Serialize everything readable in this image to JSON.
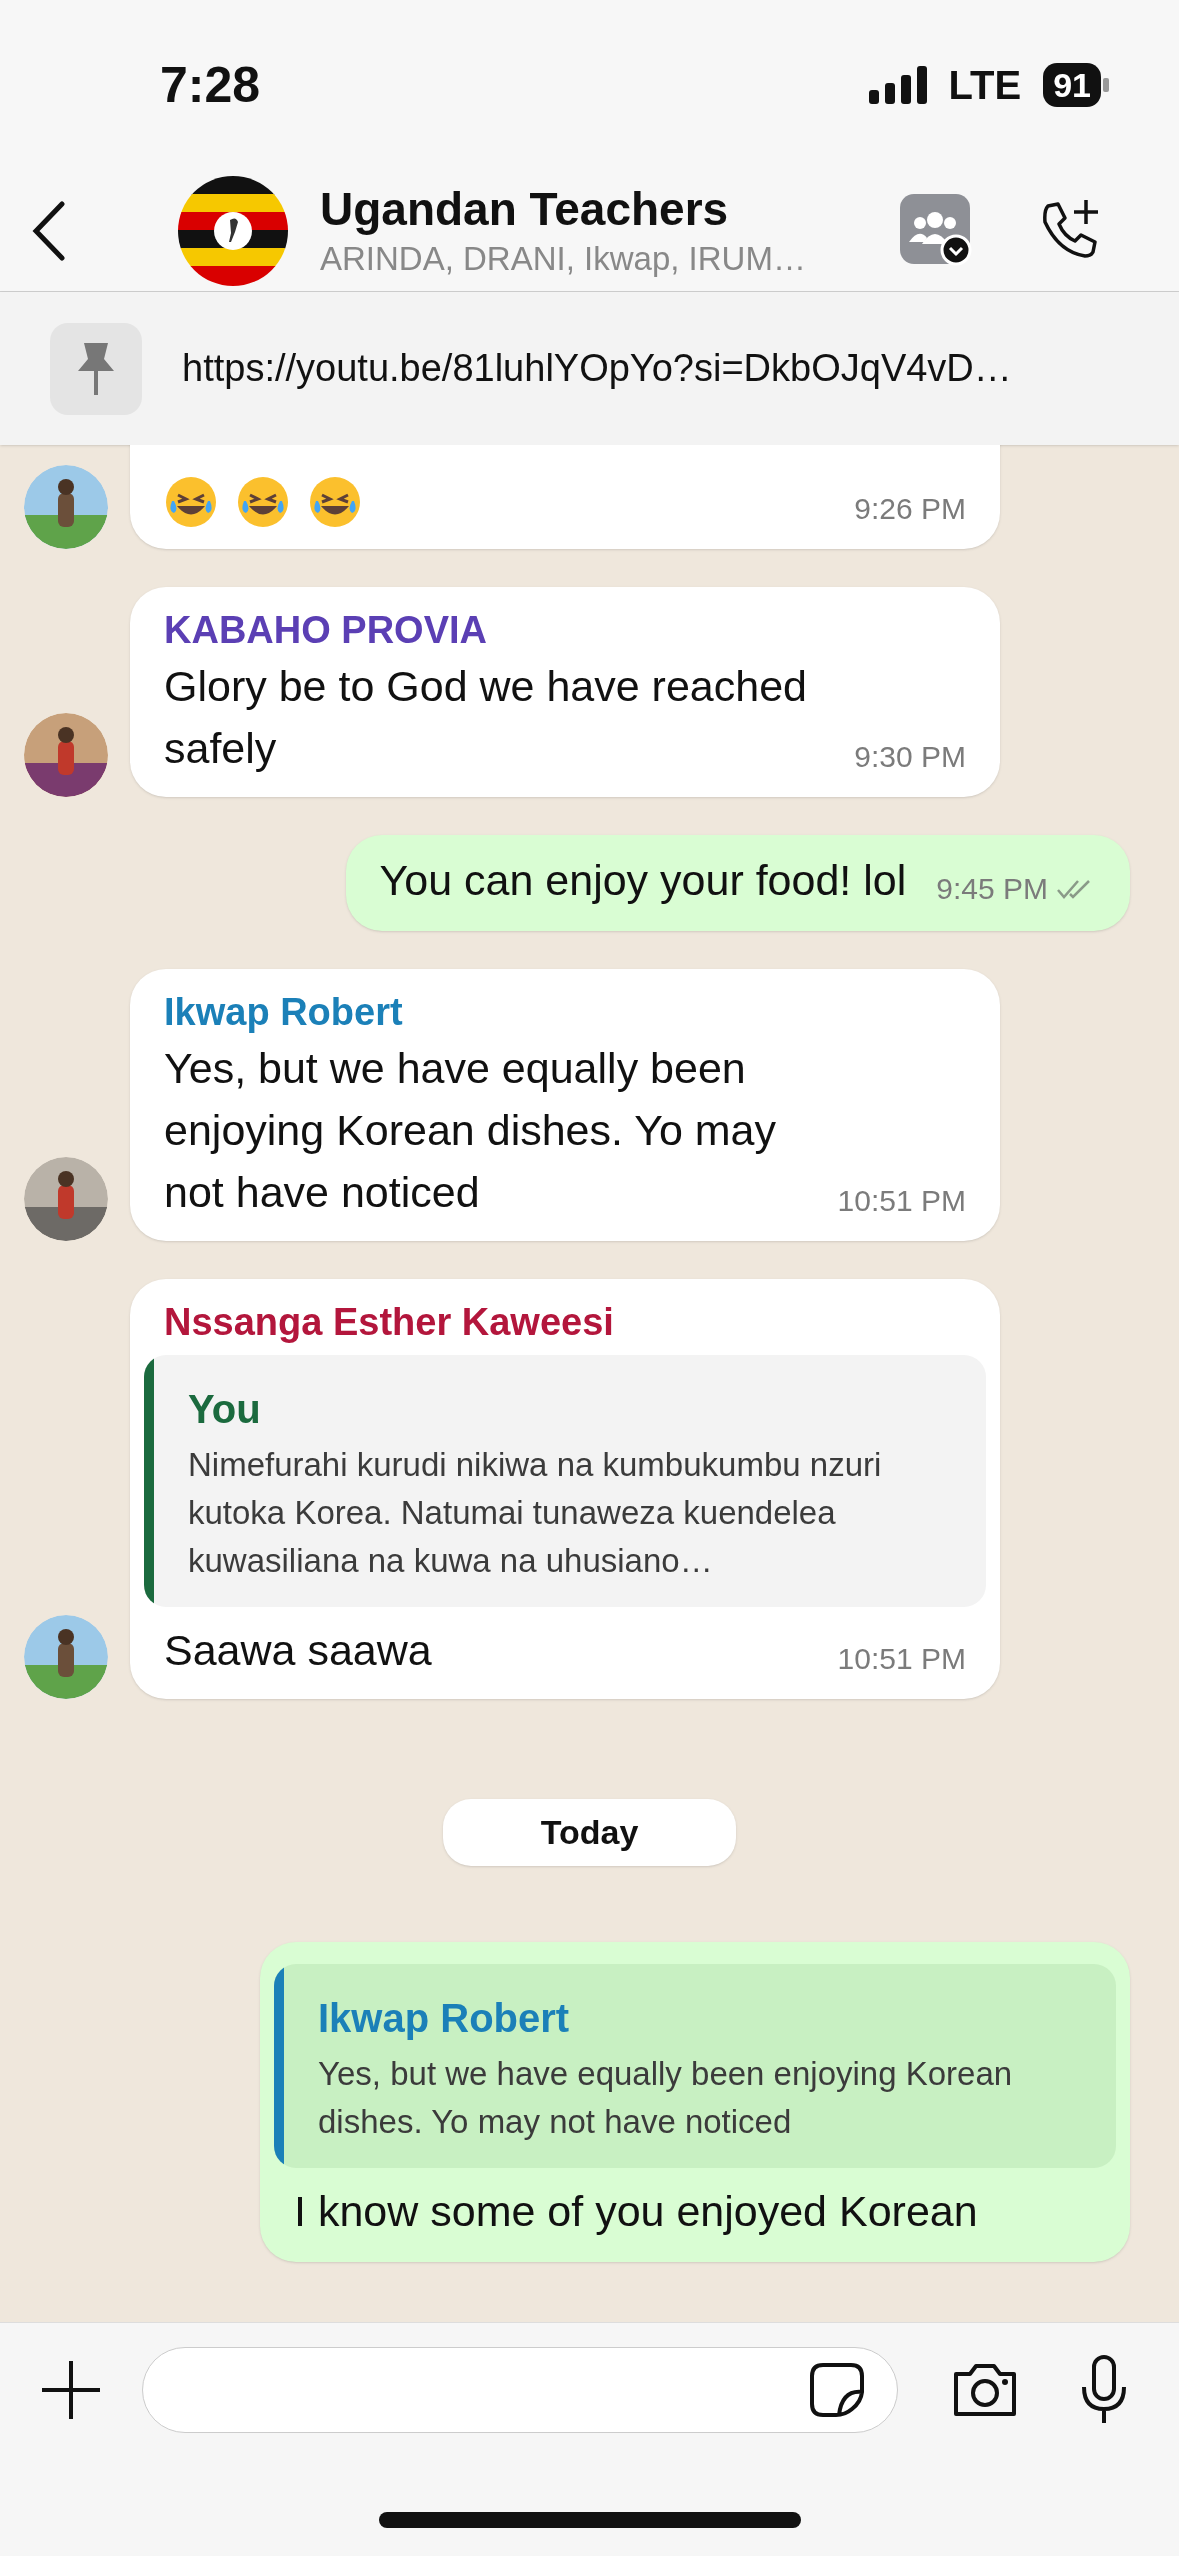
{
  "status_bar": {
    "time": "7:28",
    "network": "LTE",
    "battery": "91"
  },
  "header": {
    "title": "Ugandan Teachers",
    "subtitle": "ARINDA, DRANI, Ikwap, IRUM…"
  },
  "pinned": {
    "text": "https://youtu.be/81luhlYOpYo?si=DkbOJqV4vD…"
  },
  "messages": [
    {
      "kind": "emoji",
      "time": "9:26 PM"
    },
    {
      "kind": "incoming",
      "sender": "KABAHO PROVIA",
      "color": "#5b3fb4",
      "text": "Glory be to God we have reached safely",
      "time": "9:30 PM"
    },
    {
      "kind": "outgoing",
      "text": "You can enjoy your food! lol",
      "time": "9:45 PM",
      "read": false
    },
    {
      "kind": "incoming",
      "sender": "Ikwap Robert",
      "color": "#1b80b8",
      "text": "Yes, but we have equally been enjoying Korean dishes. Yo may not have noticed",
      "time": "10:51 PM"
    },
    {
      "kind": "incoming",
      "sender": "Nssanga Esther Kaweesi",
      "color": "#b3163c",
      "quote": {
        "author": "You",
        "color": "#1b6a3e",
        "text": "Nimefurahi kurudi nikiwa na kumbukumbu nzuri kutoka Korea. Natumai tunaweza kuendelea kuwasiliana na kuwa na uhusiano…"
      },
      "text": "Saawa saawa",
      "time": "10:51 PM"
    },
    {
      "kind": "date",
      "text": "Today"
    },
    {
      "kind": "outgoing",
      "quote": {
        "author": "Ikwap Robert",
        "color": "#1b80b8",
        "text": "Yes, but we have equally been enjoying Korean dishes. Yo may not have noticed"
      },
      "text": "I know some of you enjoyed Korean"
    }
  ]
}
